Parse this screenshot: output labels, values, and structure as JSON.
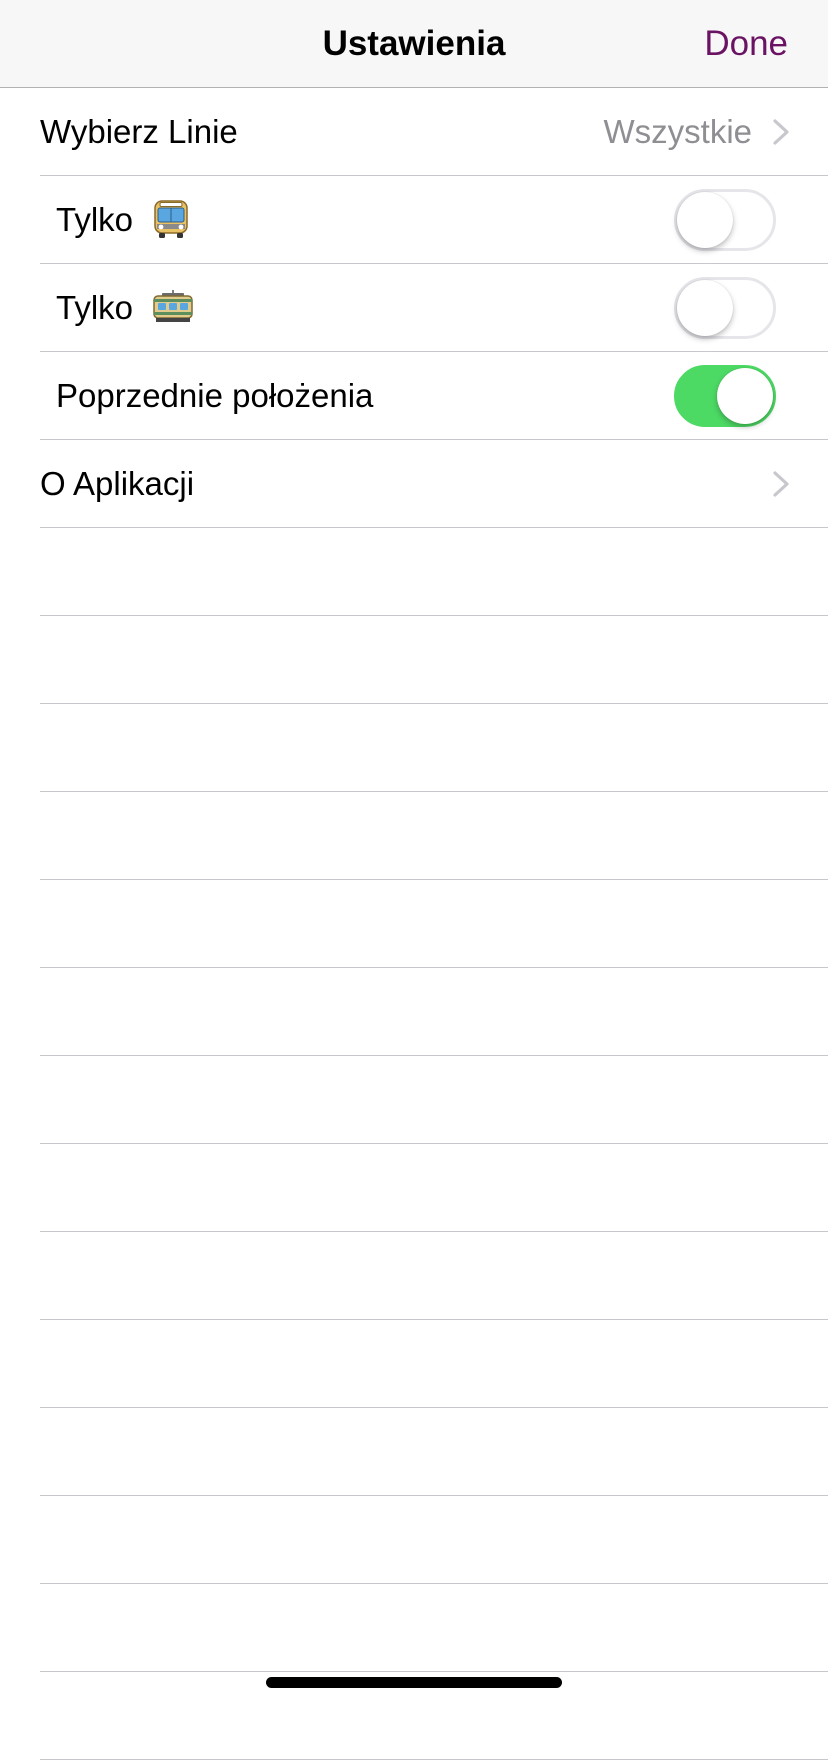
{
  "navbar": {
    "title": "Ustawienia",
    "done_label": "Done",
    "accent_color": "#6a1363"
  },
  "rows": {
    "select_lines": {
      "label": "Wybierz Linie",
      "detail": "Wszystkie",
      "icon": "chevron-right-icon"
    },
    "only_bus": {
      "label": "Tylko",
      "icon": "bus-icon",
      "toggle_on": false
    },
    "only_tram": {
      "label": "Tylko",
      "icon": "tram-icon",
      "toggle_on": false
    },
    "previous_positions": {
      "label": "Poprzednie położenia",
      "toggle_on": true,
      "toggle_color": "#4cd964"
    },
    "about": {
      "label": "O Aplikacji",
      "icon": "chevron-right-icon"
    }
  }
}
